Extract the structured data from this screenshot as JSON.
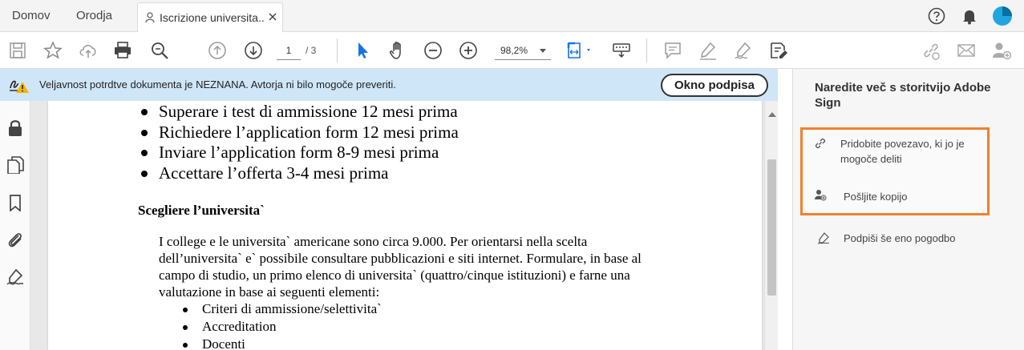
{
  "tabs": {
    "home_label": "Domov",
    "tools_label": "Orodja",
    "document_label": "Iscrizione universita..."
  },
  "toolbar": {
    "page_current": "1",
    "page_total": "/ 3",
    "zoom": "98,2%"
  },
  "notice": {
    "text": "Veljavnost potrdtve dokumenta je NEZNANA. Avtorja ni bilo mogoče preveriti.",
    "button_label": "Okno podpisa"
  },
  "document": {
    "bullets": [
      "Superare i test di ammissione 12 mesi prima",
      "Richiedere l’application form 12 mesi prima",
      "Inviare l’application form 8-9 mesi prima",
      "Accettare l’offerta 3-4 mesi prima"
    ],
    "heading": "Scegliere l’universita`",
    "paragraph_lines": [
      "I college e le universita` americane sono circa 9.000. Per orientarsi nella scelta",
      "dell’universita` e` possibile consultare pubblicazioni e siti internet. Formulare, in base al",
      "campo di studio, un primo elenco di universita` (quattro/cinque istituzioni) e farne una",
      "valutazione in base ai seguenti elementi:"
    ],
    "sub_bullets": [
      "Criteri di ammissione/selettivita`",
      "Accreditation",
      "Docenti"
    ]
  },
  "right_panel": {
    "title": "Naredite več s storitvijo Adobe Sign",
    "get_link_line1": "Pridobite povezavo, ki jo je",
    "get_link_line2": "mogoče deliti",
    "send_copy": "Pošljite kopijo",
    "sign_agreement": "Podpiši še eno pogodbo"
  },
  "colors": {
    "notice_bg": "#cfe6f8",
    "highlight_border": "#f0812d",
    "select_tool": "#1473e6",
    "avatar": "#1fa6e0"
  },
  "icons": {
    "user_tab": "user-icon",
    "close": "close-icon",
    "help": "help-icon",
    "bell": "bell-icon",
    "avatar": "avatar-icon"
  }
}
